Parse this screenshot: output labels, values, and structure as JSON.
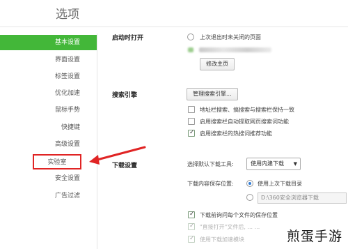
{
  "page": {
    "title": "选项"
  },
  "sidebar": {
    "items": [
      {
        "label": "基本设置"
      },
      {
        "label": "界面设置"
      },
      {
        "label": "标签设置"
      },
      {
        "label": "优化加速"
      },
      {
        "label": "鼠标手势"
      },
      {
        "label": "快捷键"
      },
      {
        "label": "高级设置"
      },
      {
        "label": "实验室"
      },
      {
        "label": "安全设置"
      },
      {
        "label": "广告过滤"
      }
    ]
  },
  "startup": {
    "title": "启动时打开",
    "option_restore": "上次退出时未关闭的页面",
    "change_home_button": "修改主页"
  },
  "search": {
    "title": "搜索引擎",
    "manage_button": "管理搜索引擎...",
    "option_sync": "地址栏搜索、搞搜索与搜索栏保持一致",
    "option_auto_keyword": "启用搜索栏自动提取网页搜索词功能",
    "option_hot_words": "启用搜索栏的热搜词推荐功能"
  },
  "download": {
    "title": "下载设置",
    "tool_label": "选择默认下载工具:",
    "tool_value": "使用内建下载",
    "save_location_label": "下载内容保存位置:",
    "option_last_dir": "使用上次下载目录",
    "path_value": "D:\\360安全浏览器下载",
    "option_ask_each": "下载前询问每个文件的保存位置",
    "option_direct_open": "\"直接打开\"文件后,   ...  ...",
    "option_accelerate": "使用下载加速模块"
  },
  "watermark": {
    "text": "煎蛋手游"
  },
  "colors": {
    "active_nav": "#43b739",
    "highlight": "#e02424",
    "radio_on": "#2f7bd6"
  }
}
